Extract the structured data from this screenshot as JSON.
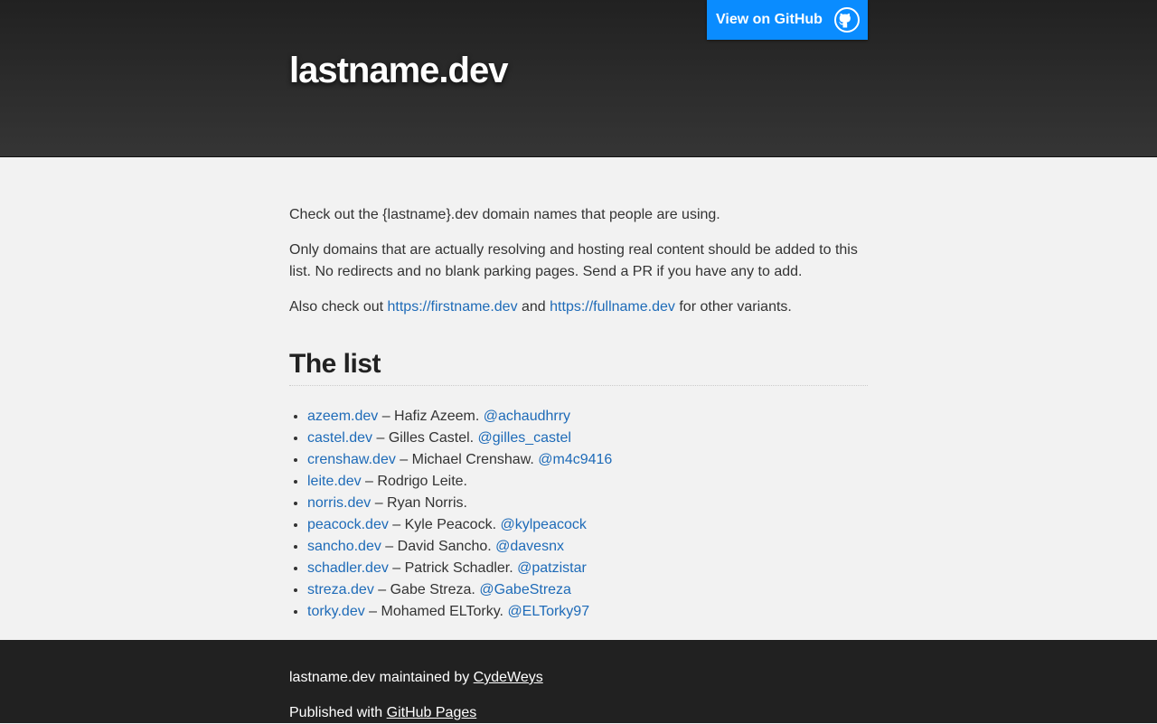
{
  "header": {
    "title": "lastname.dev",
    "github_button_label": "View on GitHub"
  },
  "intro": {
    "p1": "Check out the {lastname}.dev domain names that people are using.",
    "p2": "Only domains that are actually resolving and hosting real content should be added to this list. No redirects and no blank parking pages. Send a PR if you have any to add.",
    "p3_prefix": "Also check out ",
    "link1": "https://firstname.dev",
    "p3_mid": " and ",
    "link2": "https://fullname.dev",
    "p3_suffix": " for other variants."
  },
  "list": {
    "title": "The list",
    "items": [
      {
        "domain": "azeem.dev",
        "person": " – Hafiz Azeem. ",
        "handle": "@achaudhrry"
      },
      {
        "domain": "castel.dev",
        "person": " – Gilles Castel. ",
        "handle": "@gilles_castel"
      },
      {
        "domain": "crenshaw.dev",
        "person": " – Michael Crenshaw. ",
        "handle": "@m4c9416"
      },
      {
        "domain": "leite.dev",
        "person": " – Rodrigo Leite.",
        "handle": ""
      },
      {
        "domain": "norris.dev",
        "person": " – Ryan Norris.",
        "handle": ""
      },
      {
        "domain": "peacock.dev",
        "person": " – Kyle Peacock. ",
        "handle": "@kylpeacock"
      },
      {
        "domain": "sancho.dev",
        "person": " – David Sancho. ",
        "handle": "@davesnx"
      },
      {
        "domain": "schadler.dev",
        "person": " – Patrick Schadler. ",
        "handle": "@patzistar"
      },
      {
        "domain": "streza.dev",
        "person": " – Gabe Streza. ",
        "handle": "@GabeStreza"
      },
      {
        "domain": "torky.dev",
        "person": " – Mohamed ELTorky. ",
        "handle": "@ELTorky97"
      }
    ]
  },
  "footer": {
    "maintained_prefix": "lastname.dev maintained by ",
    "maintainer": "CydeWeys",
    "published_prefix": "Published with ",
    "published_link": "GitHub Pages"
  },
  "colors": {
    "link": "#1e6bb8",
    "github_button": "#0a8cff",
    "header_dark": "#212121",
    "page_bg": "#f2f2f2"
  },
  "icons": {
    "github_button_icon": "github-octocat-icon"
  }
}
